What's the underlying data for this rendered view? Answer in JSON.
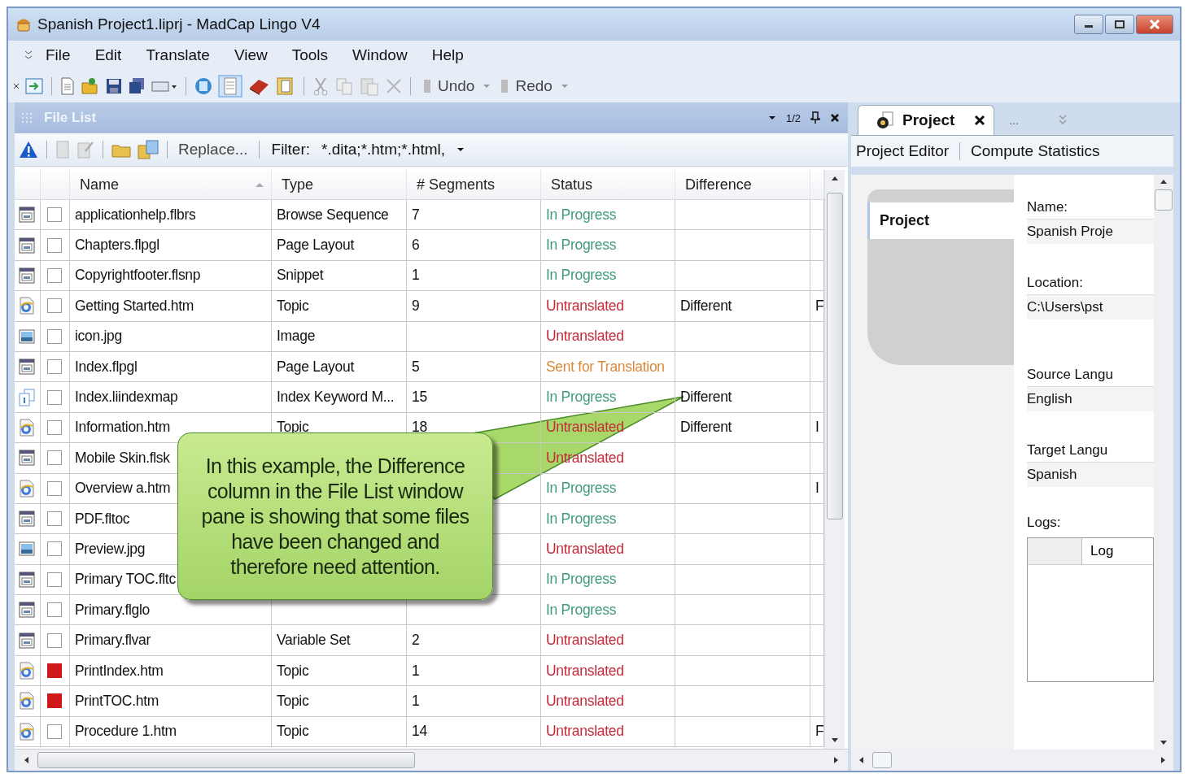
{
  "window": {
    "title": "Spanish Project1.liprj - MadCap Lingo V4"
  },
  "menu": [
    "File",
    "Edit",
    "Translate",
    "View",
    "Tools",
    "Window",
    "Help"
  ],
  "toolbar": {
    "undo": "Undo",
    "redo": "Redo"
  },
  "file_list": {
    "title": "File List",
    "page": "1/2",
    "replace": "Replace...",
    "filter_label": "Filter:",
    "filter_value": "*.dita;*.htm;*.html,",
    "columns": [
      "Name",
      "Type",
      "# Segments",
      "Status",
      "Difference"
    ],
    "rows": [
      {
        "kind": "layout",
        "marked": false,
        "name": "applicationhelp.flbrs",
        "type": "Browse Sequence",
        "segments": "7",
        "status": {
          "text": "In Progress",
          "kind": "in_progress"
        }
      },
      {
        "kind": "layout",
        "marked": false,
        "name": "Chapters.flpgl",
        "type": "Page Layout",
        "segments": "6",
        "status": {
          "text": "In Progress",
          "kind": "in_progress"
        }
      },
      {
        "kind": "layout",
        "marked": false,
        "name": "Copyrightfooter.flsnp",
        "type": "Snippet",
        "segments": "1",
        "status": {
          "text": "In Progress",
          "kind": "in_progress"
        }
      },
      {
        "kind": "topic",
        "marked": false,
        "name": "Getting Started.htm",
        "type": "Topic",
        "segments": "9",
        "status": {
          "text": "Untranslated",
          "kind": "untranslated"
        },
        "difference": "Different",
        "column_6": "F"
      },
      {
        "kind": "image",
        "marked": false,
        "name": "icon.jpg",
        "type": "Image",
        "status": {
          "text": "Untranslated",
          "kind": "untranslated"
        }
      },
      {
        "kind": "layout",
        "marked": false,
        "name": "Index.flpgl",
        "type": "Page Layout",
        "segments": "5",
        "status": {
          "text": "Sent for Translation",
          "kind": "sent"
        }
      },
      {
        "kind": "index",
        "marked": false,
        "name": "Index.liindexmap",
        "type": "Index Keyword M...",
        "segments": "15",
        "status": {
          "text": "In Progress",
          "kind": "in_progress"
        },
        "difference": "Different"
      },
      {
        "kind": "topic",
        "marked": false,
        "name": "Information.htm",
        "type": "Topic",
        "segments": "18",
        "status": {
          "text": "Untranslated",
          "kind": "untranslated"
        },
        "difference": "Different",
        "column_6": "I"
      },
      {
        "kind": "layout",
        "marked": false,
        "name": "Mobile Skin.flsk",
        "status": {
          "text": "Untranslated",
          "kind": "untranslated"
        }
      },
      {
        "kind": "topic",
        "marked": false,
        "name": "Overview a.htm",
        "status": {
          "text": "In Progress",
          "kind": "in_progress"
        },
        "column_6": "I"
      },
      {
        "kind": "layout",
        "marked": false,
        "name": "PDF.fltoc",
        "status": {
          "text": "In Progress",
          "kind": "in_progress"
        }
      },
      {
        "kind": "image",
        "marked": false,
        "name": "Preview.jpg",
        "status": {
          "text": "Untranslated",
          "kind": "untranslated"
        }
      },
      {
        "kind": "layout",
        "marked": false,
        "name": "Primary TOC.fltc",
        "status": {
          "text": "In Progress",
          "kind": "in_progress"
        }
      },
      {
        "kind": "layout",
        "marked": false,
        "name": "Primary.flglo",
        "status": {
          "text": "In Progress",
          "kind": "in_progress"
        }
      },
      {
        "kind": "layout",
        "marked": false,
        "name": "Primary.flvar",
        "type": "Variable Set",
        "segments": "2",
        "status": {
          "text": "Untranslated",
          "kind": "untranslated"
        }
      },
      {
        "kind": "topic",
        "marked": true,
        "name": "PrintIndex.htm",
        "type": "Topic",
        "segments": "1",
        "status": {
          "text": "Untranslated",
          "kind": "untranslated"
        }
      },
      {
        "kind": "topic",
        "marked": true,
        "name": "PrintTOC.htm",
        "type": "Topic",
        "segments": "1",
        "status": {
          "text": "Untranslated",
          "kind": "untranslated"
        }
      },
      {
        "kind": "topic",
        "marked": false,
        "name": "Procedure 1.htm",
        "type": "Topic",
        "segments": "14",
        "status": {
          "text": "Untranslated",
          "kind": "untranslated"
        },
        "column_6": "F"
      }
    ]
  },
  "callout": "In this example, the Difference column in the File List window pane is showing that some files have been changed and therefore need attention.",
  "project_pane": {
    "tab": "Project",
    "more": "...",
    "links": [
      "Project Editor",
      "Compute Statistics"
    ],
    "nav": [
      {
        "label": "Project",
        "selected": true
      }
    ],
    "fields": [
      {
        "label": "Name:",
        "value": "Spanish Proje"
      },
      {
        "label": "Location:",
        "value": "C:\\Users\\pst"
      },
      {
        "label": "Source Langu",
        "value": "English"
      },
      {
        "label": "Target Langu",
        "value": "Spanish"
      }
    ],
    "logs_label": "Logs:",
    "logs_column": "Log"
  }
}
